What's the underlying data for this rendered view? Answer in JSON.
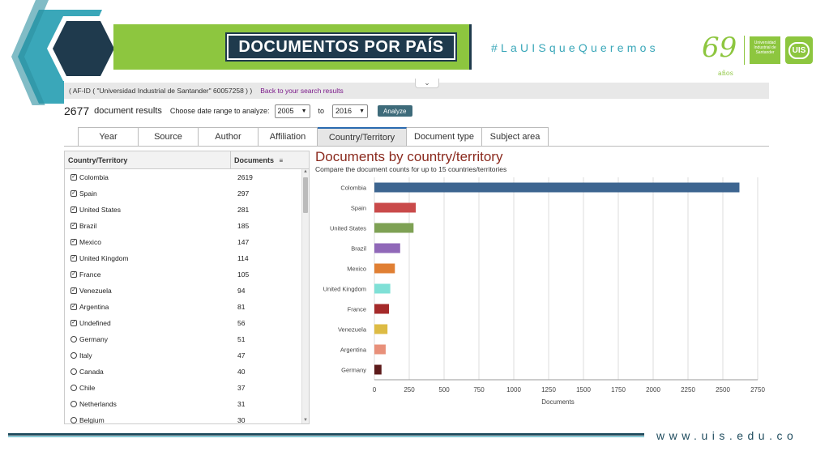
{
  "banner": {
    "title": "DOCUMENTOS POR PAÍS",
    "hashtag": "#LaUISqueQueremos",
    "logo_69": "69",
    "logo_anos": "años",
    "logo_uis_text": "Universidad Industrial de Santander",
    "logo_uis_badge": "UIS",
    "colors": {
      "green": "#8dc63f",
      "navy": "#1f3a4d",
      "teal": "#3aa7b9"
    }
  },
  "afid": {
    "text": "( AF-ID ( \"Universidad Industrial de Santander\"   60057258 ) )",
    "back_link": "Back to your search results"
  },
  "results": {
    "count": "2677",
    "count_label": "document results",
    "range_label": "Choose date range to analyze:",
    "from_value": "2005",
    "to_label": "to",
    "to_value": "2016",
    "analyze_label": "Analyze"
  },
  "tabs": [
    {
      "label": "Year",
      "active": false
    },
    {
      "label": "Source",
      "active": false
    },
    {
      "label": "Author",
      "active": false
    },
    {
      "label": "Affiliation",
      "active": false
    },
    {
      "label": "Country/Territory",
      "active": true
    },
    {
      "label": "Document type",
      "active": false
    },
    {
      "label": "Subject area",
      "active": false
    }
  ],
  "table": {
    "col1": "Country/Territory",
    "col2": "Documents",
    "rows": [
      {
        "country": "Colombia",
        "docs": "2619",
        "checked": true
      },
      {
        "country": "Spain",
        "docs": "297",
        "checked": true
      },
      {
        "country": "United States",
        "docs": "281",
        "checked": true
      },
      {
        "country": "Brazil",
        "docs": "185",
        "checked": true
      },
      {
        "country": "Mexico",
        "docs": "147",
        "checked": true
      },
      {
        "country": "United Kingdom",
        "docs": "114",
        "checked": true
      },
      {
        "country": "France",
        "docs": "105",
        "checked": true
      },
      {
        "country": "Venezuela",
        "docs": "94",
        "checked": true
      },
      {
        "country": "Argentina",
        "docs": "81",
        "checked": true
      },
      {
        "country": "Undefined",
        "docs": "56",
        "checked": true
      },
      {
        "country": "Germany",
        "docs": "51",
        "checked": false
      },
      {
        "country": "Italy",
        "docs": "47",
        "checked": false
      },
      {
        "country": "Canada",
        "docs": "40",
        "checked": false
      },
      {
        "country": "Chile",
        "docs": "37",
        "checked": false
      },
      {
        "country": "Netherlands",
        "docs": "31",
        "checked": false
      },
      {
        "country": "Belgium",
        "docs": "30",
        "checked": false
      }
    ]
  },
  "chart_data": {
    "type": "bar",
    "orientation": "horizontal",
    "title": "Documents by country/territory",
    "subtitle": "Compare the document counts for up to 15 countries/territories",
    "xlabel": "Documents",
    "ylabel": "",
    "xlim": [
      0,
      2750
    ],
    "xticks": [
      0,
      250,
      500,
      750,
      1000,
      1250,
      1500,
      1750,
      2000,
      2250,
      2500,
      2750
    ],
    "grid": true,
    "categories": [
      "Colombia",
      "Spain",
      "United States",
      "Brazil",
      "Mexico",
      "United Kingdom",
      "France",
      "Venezuela",
      "Argentina",
      "Germany"
    ],
    "values": [
      2619,
      297,
      281,
      185,
      147,
      114,
      105,
      94,
      81,
      51
    ],
    "colors": [
      "#3d6590",
      "#c94a4a",
      "#7ea154",
      "#9068b8",
      "#e07f33",
      "#7fe0d6",
      "#a52a2a",
      "#ddbb44",
      "#e8907a",
      "#5c1a1a"
    ]
  },
  "footer": {
    "url": "www.uis.edu.co"
  }
}
